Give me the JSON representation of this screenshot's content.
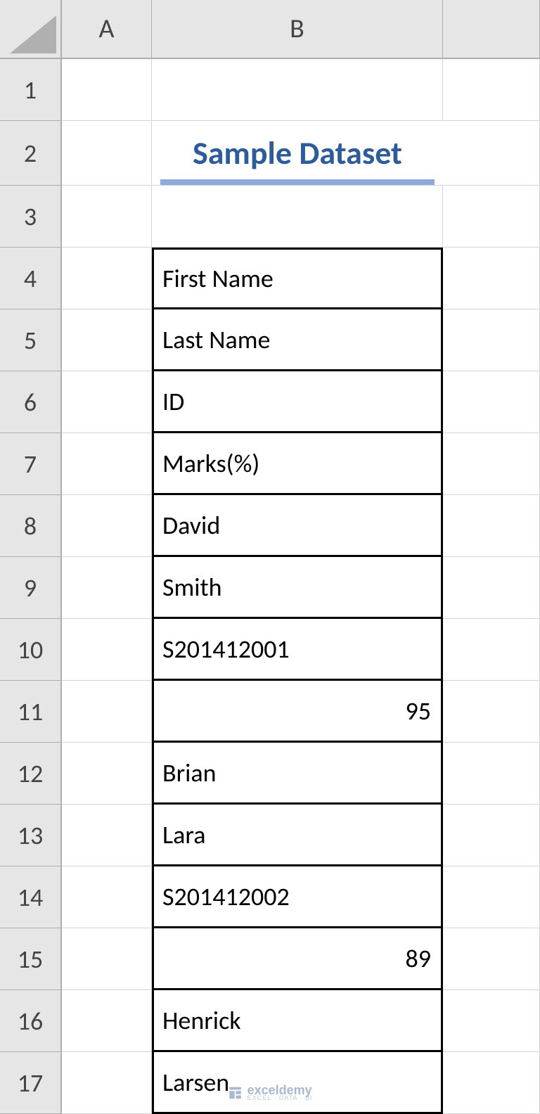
{
  "columns": {
    "A": "A",
    "B": "B"
  },
  "rows": [
    "1",
    "2",
    "3",
    "4",
    "5",
    "6",
    "7",
    "8",
    "9",
    "10",
    "11",
    "12",
    "13",
    "14",
    "15",
    "16",
    "17"
  ],
  "title": "Sample Dataset",
  "cells": {
    "b4": "First Name",
    "b5": "Last Name",
    "b6": "ID",
    "b7": "Marks(%)",
    "b8": "David",
    "b9": "Smith",
    "b10": "S201412001",
    "b11": "95",
    "b12": "Brian",
    "b13": "Lara",
    "b14": "S201412002",
    "b15": "89",
    "b16": "Henrick",
    "b17": "Larsen"
  },
  "watermark": {
    "brand": "exceldemy",
    "tagline": "EXCEL · DATA · BI"
  }
}
